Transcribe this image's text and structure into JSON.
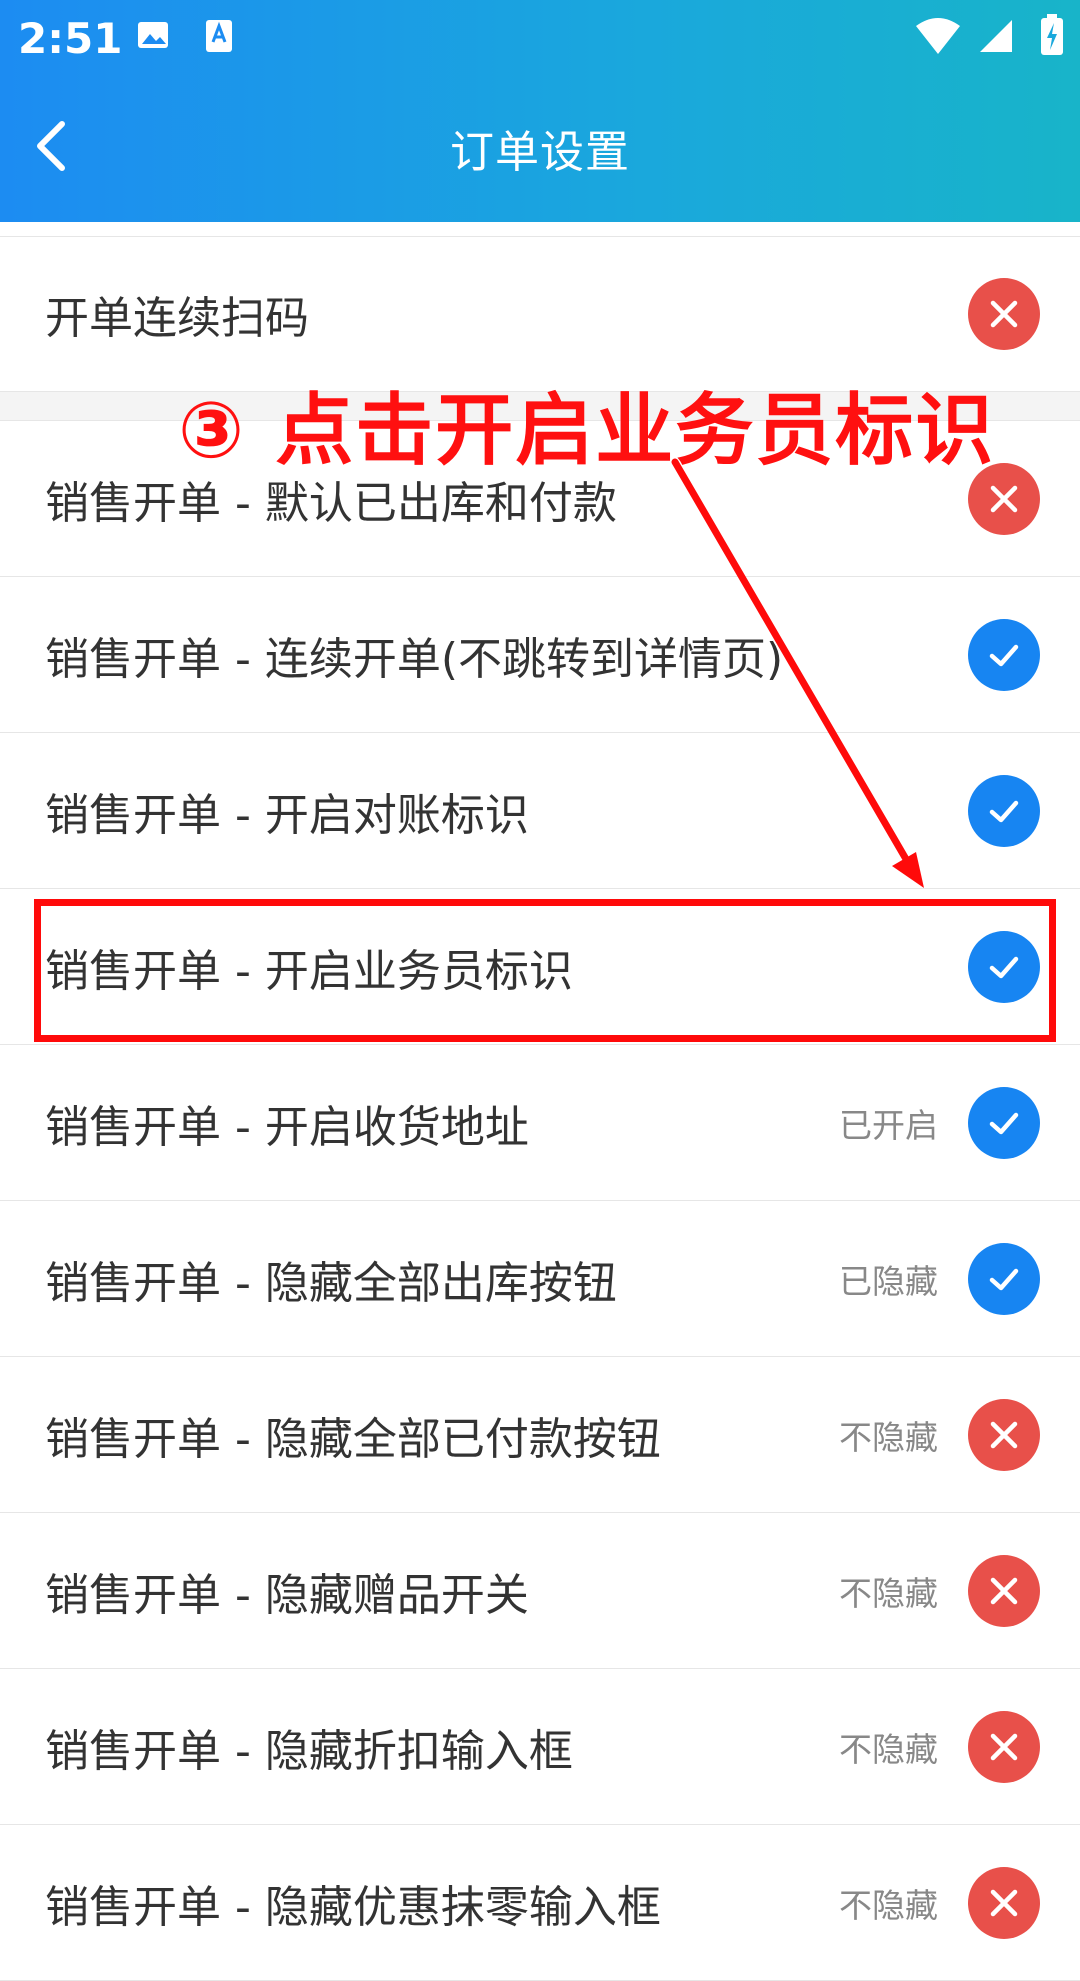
{
  "status_bar": {
    "time": "2:51"
  },
  "header": {
    "title": "订单设置"
  },
  "rows": [
    {
      "label": "开单连续扫码",
      "status": "",
      "enabled": false
    },
    {
      "label": "销售开单 - 默认已出库和付款",
      "status": "",
      "enabled": false
    },
    {
      "label": "销售开单 - 连续开单(不跳转到详情页)",
      "status": "",
      "enabled": true
    },
    {
      "label": "销售开单 - 开启对账标识",
      "status": "",
      "enabled": true
    },
    {
      "label": "销售开单 - 开启业务员标识",
      "status": "",
      "enabled": true
    },
    {
      "label": "销售开单 - 开启收货地址",
      "status": "已开启",
      "enabled": true
    },
    {
      "label": "销售开单 - 隐藏全部出库按钮",
      "status": "已隐藏",
      "enabled": true
    },
    {
      "label": "销售开单 - 隐藏全部已付款按钮",
      "status": "不隐藏",
      "enabled": false
    },
    {
      "label": "销售开单 - 隐藏赠品开关",
      "status": "不隐藏",
      "enabled": false
    },
    {
      "label": "销售开单 - 隐藏折扣输入框",
      "status": "不隐藏",
      "enabled": false
    },
    {
      "label": "销售开单 - 隐藏优惠抹零输入框",
      "status": "不隐藏",
      "enabled": false
    }
  ],
  "annotation": {
    "text": "③ 点击开启业务员标识"
  },
  "colors": {
    "header_start": "#1c8cf2",
    "header_end": "#18b4c9",
    "on": "#1785f2",
    "off": "#e8504a",
    "annotation": "#ff0a0a"
  }
}
